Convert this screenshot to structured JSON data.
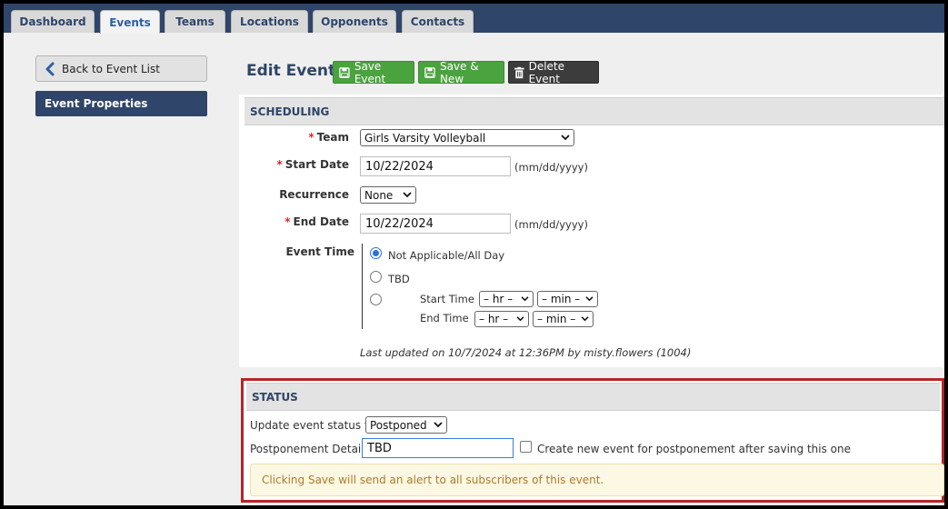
{
  "tabs": [
    "Dashboard",
    "Events",
    "Teams",
    "Locations",
    "Opponents",
    "Contacts"
  ],
  "active_tab": "Events",
  "sidebar": {
    "back_label": "Back to Event List",
    "items": [
      {
        "label": "Event Properties"
      }
    ]
  },
  "header": {
    "title": "Edit Event",
    "save_label": "Save Event",
    "save_new_label": "Save & New",
    "delete_label": "Delete Event"
  },
  "scheduling": {
    "heading": "SCHEDULING",
    "team_label": "Team",
    "team_value": "Girls Varsity Volleyball",
    "start_date_label": "Start Date",
    "start_date_value": "10/22/2024",
    "date_hint": "(mm/dd/yyyy)",
    "recurrence_label": "Recurrence",
    "recurrence_value": "None",
    "end_date_label": "End Date",
    "end_date_value": "10/22/2024",
    "event_time_label": "Event Time",
    "opt_all_day": "Not Applicable/All Day",
    "opt_tbd": "TBD",
    "start_time_label": "Start Time",
    "end_time_label": "End Time",
    "hr_placeholder": "– hr –",
    "min_placeholder": "– min –",
    "last_updated": "Last updated on 10/7/2024 at 12:36PM by misty.flowers (1004)"
  },
  "status": {
    "heading": "STATUS",
    "update_label": "Update event status to:",
    "status_value": "Postponed",
    "postpone_label": "Postponement Details:",
    "postpone_value": "TBD",
    "create_new_label": "Create new event for postponement after saving this one",
    "alert_text": "Clicking Save will send an alert to all subscribers of this event."
  },
  "colors": {
    "nav": "#2f4569",
    "green": "#4aa33e",
    "highlight_border": "#b3262a",
    "required": "#d42a2a"
  }
}
